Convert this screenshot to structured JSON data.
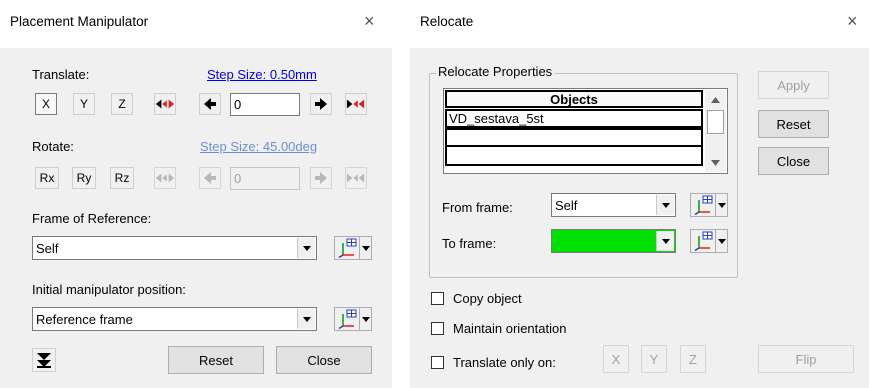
{
  "placement": {
    "title": "Placement Manipulator",
    "close_glyph": "×",
    "translate_label": "Translate:",
    "translate_step": "Step Size: 0.50mm",
    "axes": [
      "X",
      "Y",
      "Z"
    ],
    "translate_value": "0",
    "rotate_label": "Rotate:",
    "rotate_step": "Step Size: 45.00deg",
    "rot_axes": [
      "Rx",
      "Ry",
      "Rz"
    ],
    "rotate_value": "0",
    "frame_label": "Frame of Reference:",
    "frame_value": "Self",
    "initial_label": "Initial manipulator position:",
    "initial_value": "Reference frame",
    "reset_label": "Reset",
    "close_label": "Close"
  },
  "relocate": {
    "title": "Relocate",
    "close_glyph": "×",
    "group_label": "Relocate Properties",
    "table_header": "Objects",
    "rows": [
      "VD_sestava_5st",
      "",
      ""
    ],
    "from_label": "From frame:",
    "from_value": "Self",
    "to_label": "To frame:",
    "to_value": "",
    "to_color": "#00e000",
    "apply_label": "Apply",
    "reset_label": "Reset",
    "close_label": "Close",
    "copy_label": "Copy object",
    "maintain_label": "Maintain orientation",
    "translate_only_label": "Translate only on:",
    "axes": [
      "X",
      "Y",
      "Z"
    ],
    "flip_label": "Flip"
  }
}
